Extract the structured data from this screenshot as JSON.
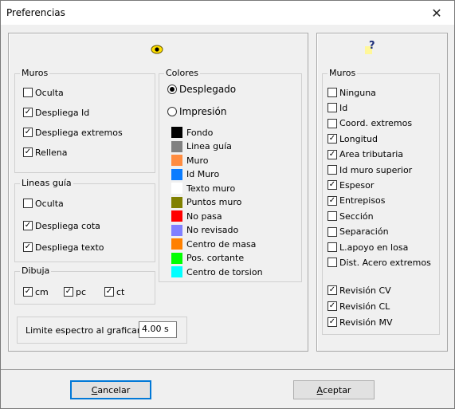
{
  "window": {
    "title": "Preferencias",
    "close_glyph": "✕"
  },
  "left": {
    "muros": {
      "legend": "Muros",
      "items": [
        {
          "label": "Oculta",
          "checked": false
        },
        {
          "label": "Despliega Id",
          "checked": true
        },
        {
          "label": "Despliega extremos",
          "checked": true
        },
        {
          "label": "Rellena",
          "checked": true
        }
      ]
    },
    "lineas": {
      "legend": "Lineas guía",
      "items": [
        {
          "label": "Oculta",
          "checked": false
        },
        {
          "label": "Despliega cota",
          "checked": true
        },
        {
          "label": "Despliega texto",
          "checked": true
        }
      ]
    },
    "dibuja": {
      "legend": "Dibuja",
      "items": [
        {
          "label": "cm",
          "checked": true
        },
        {
          "label": "pc",
          "checked": true
        },
        {
          "label": "ct",
          "checked": true
        }
      ]
    },
    "colores": {
      "legend": "Colores",
      "radios": [
        {
          "label": "Desplegado",
          "selected": true
        },
        {
          "label": "Impresión",
          "selected": false
        }
      ],
      "items": [
        {
          "label": "Fondo",
          "color": "#000000"
        },
        {
          "label": "Linea guía",
          "color": "#808080"
        },
        {
          "label": "Muro",
          "color": "#ff8c40"
        },
        {
          "label": "Id Muro",
          "color": "#0a7cff"
        },
        {
          "label": "Texto muro",
          "color": "#ffffff"
        },
        {
          "label": "Puntos muro",
          "color": "#808000"
        },
        {
          "label": "No pasa",
          "color": "#ff0000"
        },
        {
          "label": "No revisado",
          "color": "#8080ff"
        },
        {
          "label": "Centro de masa",
          "color": "#ff8000"
        },
        {
          "label": "Pos. cortante",
          "color": "#00ff00"
        },
        {
          "label": "Centro de torsion",
          "color": "#00ffff"
        }
      ]
    },
    "espectro": {
      "label": "Limite espectro al graficar",
      "value": "4.00 s"
    }
  },
  "right": {
    "muros": {
      "legend": "Muros",
      "items": [
        {
          "label": "Ninguna",
          "checked": false
        },
        {
          "label": "Id",
          "checked": false
        },
        {
          "label": "Coord. extremos",
          "checked": false
        },
        {
          "label": "Longitud",
          "checked": true
        },
        {
          "label": "Area tributaria",
          "checked": true
        },
        {
          "label": "Id muro superior",
          "checked": false
        },
        {
          "label": "Espesor",
          "checked": true
        },
        {
          "label": "Entrepisos",
          "checked": true
        },
        {
          "label": "Sección",
          "checked": false
        },
        {
          "label": "Separación",
          "checked": false
        },
        {
          "label": "L.apoyo en losa",
          "checked": false
        },
        {
          "label": "Dist. Acero extremos",
          "checked": false
        }
      ],
      "revision": [
        {
          "label": "Revisión CV",
          "checked": true
        },
        {
          "label": "Revisión CL",
          "checked": true
        },
        {
          "label": "Revisión MV",
          "checked": true
        }
      ]
    },
    "help_glyph": "?"
  },
  "buttons": {
    "cancel_first": "C",
    "cancel_rest": "ancelar",
    "accept_first": "A",
    "accept_rest": "ceptar"
  },
  "icons": {
    "eye": "eye-icon",
    "help": "help-icon"
  },
  "checkmark": "✓"
}
